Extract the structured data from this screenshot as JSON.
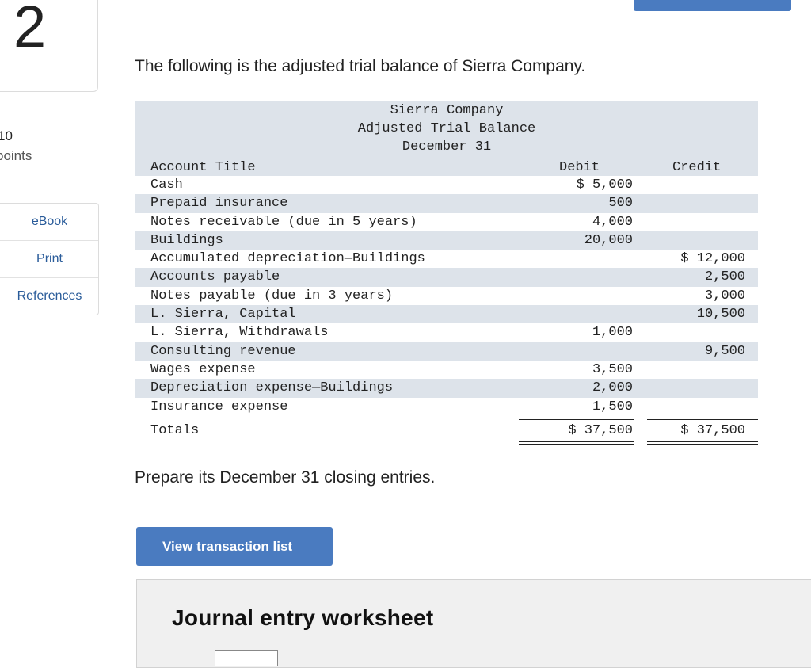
{
  "sidebar": {
    "question_number": "2",
    "points_value": "10",
    "points_label": "points",
    "menu": [
      {
        "label": "eBook"
      },
      {
        "label": "Print"
      },
      {
        "label": "References"
      }
    ]
  },
  "intro_text": "The following is the adjusted trial balance of Sierra Company.",
  "trial_balance": {
    "company": "Sierra Company",
    "title": "Adjusted Trial Balance",
    "date": "December 31",
    "col_account": "Account Title",
    "col_debit": "Debit",
    "col_credit": "Credit",
    "rows": [
      {
        "account": "Cash",
        "debit": "$ 5,000",
        "credit": ""
      },
      {
        "account": "Prepaid insurance",
        "debit": "500",
        "credit": ""
      },
      {
        "account": "Notes receivable (due in 5 years)",
        "debit": "4,000",
        "credit": ""
      },
      {
        "account": "Buildings",
        "debit": "20,000",
        "credit": ""
      },
      {
        "account": "Accumulated depreciation—Buildings",
        "debit": "",
        "credit": "$ 12,000"
      },
      {
        "account": "Accounts payable",
        "debit": "",
        "credit": "2,500"
      },
      {
        "account": "Notes payable (due in 3 years)",
        "debit": "",
        "credit": "3,000"
      },
      {
        "account": "L. Sierra, Capital",
        "debit": "",
        "credit": "10,500"
      },
      {
        "account": "L. Sierra, Withdrawals",
        "debit": "1,000",
        "credit": ""
      },
      {
        "account": "Consulting revenue",
        "debit": "",
        "credit": "9,500"
      },
      {
        "account": "Wages expense",
        "debit": "3,500",
        "credit": ""
      },
      {
        "account": "Depreciation expense—Buildings",
        "debit": "2,000",
        "credit": ""
      },
      {
        "account": "Insurance expense",
        "debit": "1,500",
        "credit": ""
      }
    ],
    "totals": {
      "label": "Totals",
      "debit": "$ 37,500",
      "credit": "$ 37,500"
    }
  },
  "prompt_text": "Prepare its December 31 closing entries.",
  "view_button_label": "View transaction list",
  "worksheet_title": "Journal entry worksheet"
}
